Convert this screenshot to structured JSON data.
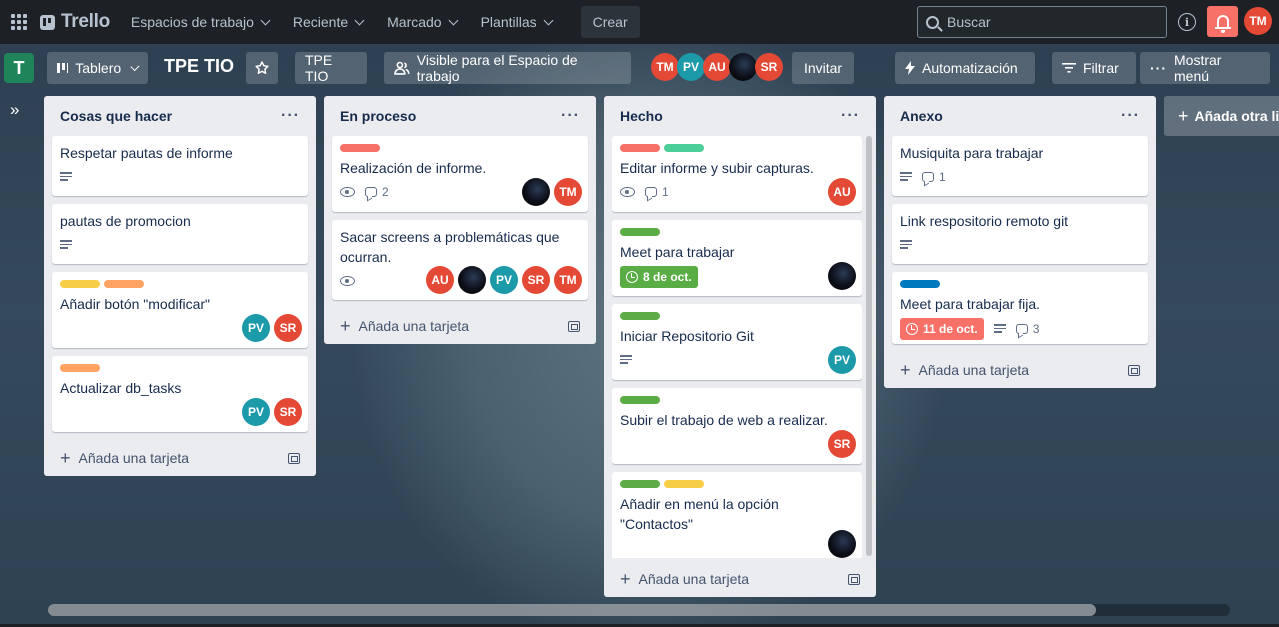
{
  "topbar": {
    "app_name": "Trello",
    "nav": [
      {
        "label": "Espacios de trabajo"
      },
      {
        "label": "Reciente"
      },
      {
        "label": "Marcado"
      },
      {
        "label": "Plantillas"
      }
    ],
    "create_label": "Crear",
    "search_placeholder": "Buscar",
    "user_initials": "TM"
  },
  "board": {
    "workspace_initial": "T",
    "view_label": "Tablero",
    "title": "TPE TIO",
    "workspace_label": "TPE TIO",
    "visibility_label": "Visible para el Espacio de trabajo",
    "members": [
      "TM",
      "PV",
      "AU",
      "",
      "SR"
    ],
    "invite_label": "Invitar",
    "automation_label": "Automatización",
    "filter_label": "Filtrar",
    "menu_label": "Mostrar menú",
    "add_list_label": "Añada otra lis"
  },
  "colors": {
    "label_red": "#f87168",
    "label_green": "#4bce97",
    "label_dark_green": "#5aac44",
    "label_yellow": "#f5cd47",
    "label_orange": "#fea362",
    "label_blue": "#0079bf",
    "avatar_red": "#e34935",
    "avatar_teal": "#1d9aaa",
    "due_green": "#5aac44",
    "due_red": "#f87168",
    "topbar_bg": "#1d2125"
  },
  "lists": [
    {
      "title": "Cosas que hacer",
      "add_label": "Añada una tarjeta",
      "cards": [
        {
          "title": "Respetar pautas de informe"
        },
        {
          "title": "pautas de promocion"
        },
        {
          "title": "Añadir botón \"modificar\"",
          "members": [
            "PV",
            "SR"
          ]
        },
        {
          "title": "Actualizar db_tasks",
          "members": [
            "PV",
            "SR"
          ]
        }
      ]
    },
    {
      "title": "En proceso",
      "add_label": "Añada una tarjeta",
      "cards": [
        {
          "title": "Realización de informe.",
          "comments": "2",
          "members": [
            "",
            "TM"
          ]
        },
        {
          "title": "Sacar screens a problemáticas que ocurran.",
          "members": [
            "AU",
            "",
            "PV",
            "SR",
            "TM"
          ]
        }
      ]
    },
    {
      "title": "Hecho",
      "add_label": "Añada una tarjeta",
      "cards": [
        {
          "title": "Editar informe y subir capturas.",
          "comments": "1",
          "members": [
            "AU"
          ]
        },
        {
          "title": "Meet para trabajar",
          "due": "8 de oct.",
          "members": [
            ""
          ]
        },
        {
          "title": "Iniciar Repositorio Git",
          "members": [
            "PV"
          ]
        },
        {
          "title": "Subir el trabajo de web a realizar.",
          "members": [
            "SR"
          ]
        },
        {
          "title": "Añadir en menú la opción \"Contactos\"",
          "members": [
            ""
          ]
        }
      ]
    },
    {
      "title": "Anexo",
      "add_label": "Añada una tarjeta",
      "cards": [
        {
          "title": "Musiquita para trabajar",
          "comments": "1"
        },
        {
          "title": "Link respositorio remoto git"
        },
        {
          "title": "Meet para trabajar fija.",
          "due": "11 de oct.",
          "comments": "3"
        }
      ]
    }
  ]
}
